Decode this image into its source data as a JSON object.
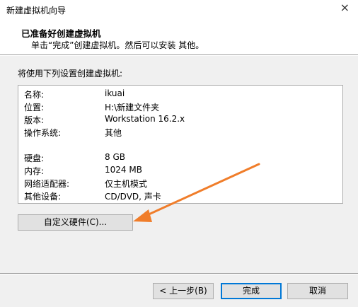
{
  "window": {
    "title": "新建虚拟机向导",
    "close_glyph": "×"
  },
  "header": {
    "title": "已准备好创建虚拟机",
    "subtitle": "单击“完成”创建虚拟机。然后可以安装 其他。"
  },
  "summary": {
    "intro": "将使用下列设置创建虚拟机:",
    "rows": [
      {
        "key": "名称:",
        "value": "ikuai"
      },
      {
        "key": "位置:",
        "value": "H:\\新建文件夹"
      },
      {
        "key": "版本:",
        "value": "Workstation 16.2.x"
      },
      {
        "key": "操作系统:",
        "value": "其他"
      },
      {
        "key": "硬盘:",
        "value": "8 GB"
      },
      {
        "key": "内存:",
        "value": "1024 MB"
      },
      {
        "key": "网络适配器:",
        "value": "仅主机模式"
      },
      {
        "key": "其他设备:",
        "value": "CD/DVD, 声卡"
      }
    ]
  },
  "buttons": {
    "customize_hardware": "自定义硬件(C)...",
    "back": "< 上一步(B)",
    "finish": "完成",
    "cancel": "取消"
  },
  "colors": {
    "annotation_arrow": "#f07d2a",
    "focus_border": "#0078d7"
  }
}
